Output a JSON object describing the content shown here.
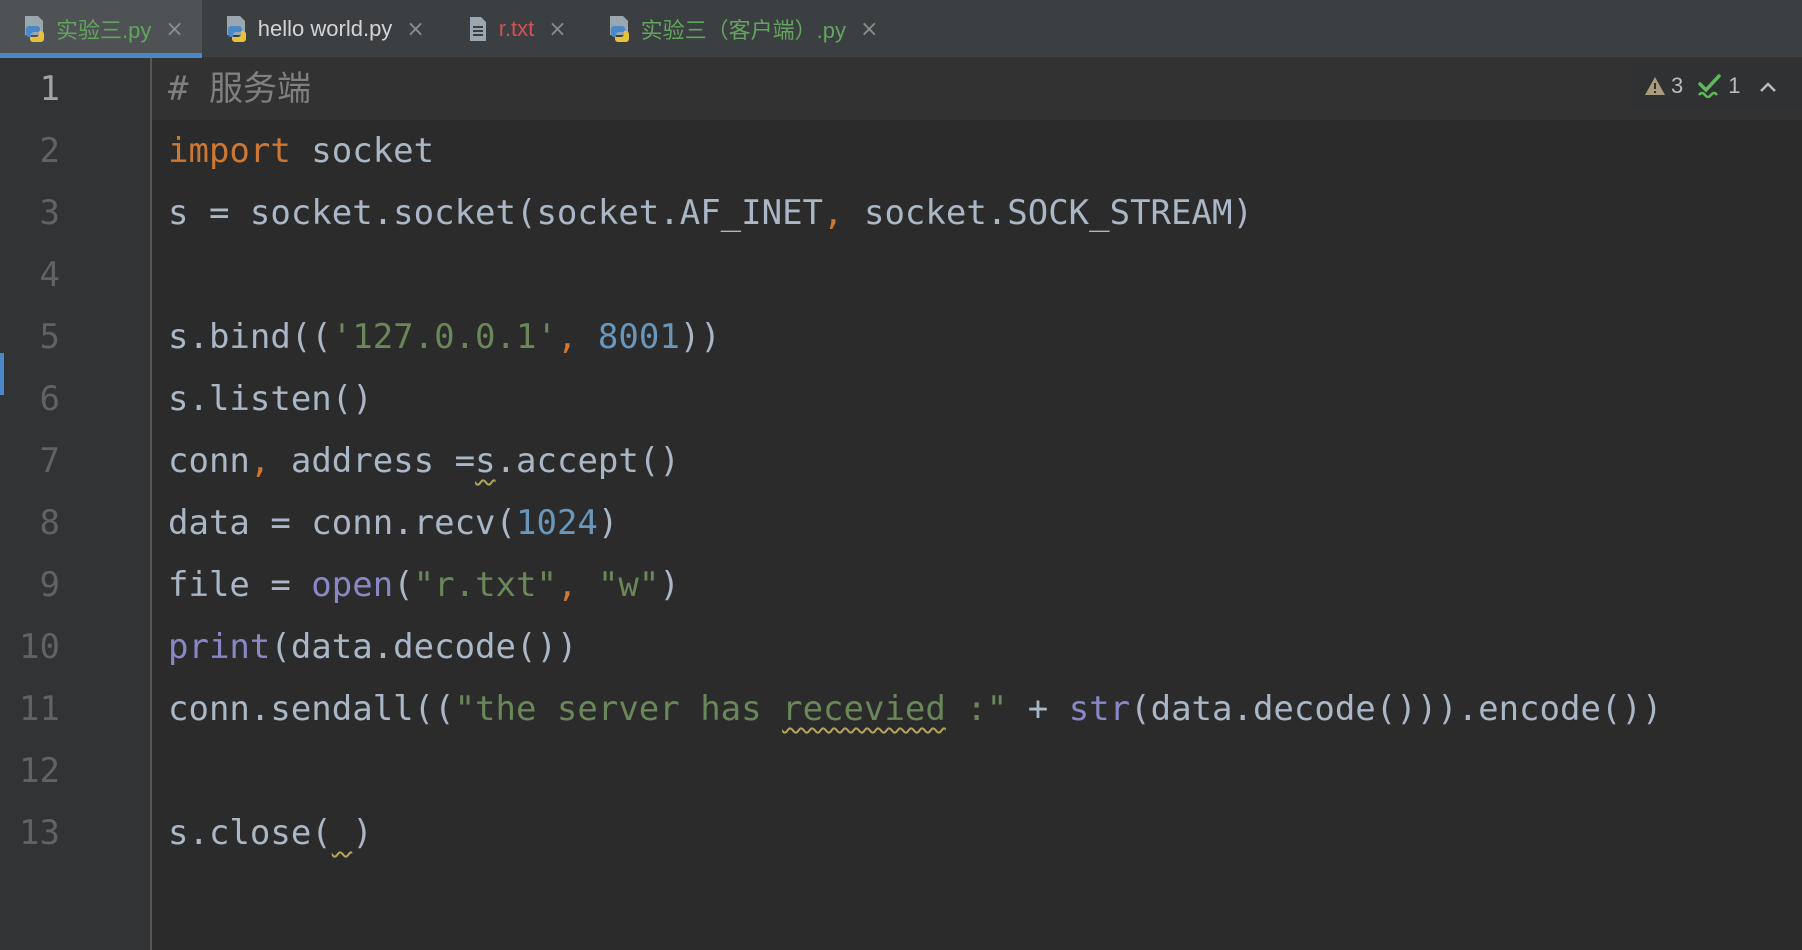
{
  "tabs": [
    {
      "label": "实验三.py",
      "type": "python",
      "color": "#62a55e",
      "active": true
    },
    {
      "label": "hello world.py",
      "type": "python",
      "color": "#d4d4d4",
      "active": false
    },
    {
      "label": "r.txt",
      "type": "text",
      "color": "#d25252",
      "active": false
    },
    {
      "label": "实验三（客户端）.py",
      "type": "python",
      "color": "#62a55e",
      "active": false
    }
  ],
  "tab_close_glyph": "×",
  "inspections": {
    "warnings_count": "3",
    "weak_warnings_count": "1",
    "warning_icon": "warning-triangle-icon",
    "weak_warning_icon": "check-squiggle-icon",
    "collapse_icon": "chevron-up-icon"
  },
  "editor": {
    "current_line": 1,
    "line_numbers": [
      "1",
      "2",
      "3",
      "4",
      "5",
      "6",
      "7",
      "8",
      "9",
      "10",
      "11",
      "12",
      "13"
    ],
    "lines": [
      {
        "tokens": [
          {
            "t": "# 服务端",
            "c": "comment"
          }
        ]
      },
      {
        "tokens": [
          {
            "t": "import",
            "c": "kw"
          },
          {
            "t": " socket",
            "c": "default"
          }
        ]
      },
      {
        "tokens": [
          {
            "t": "s = socket.socket(socket.AF_INET",
            "c": "default"
          },
          {
            "t": ",",
            "c": "comma"
          },
          {
            "t": " socket.SOCK_STREAM)",
            "c": "default"
          }
        ]
      },
      {
        "tokens": []
      },
      {
        "tokens": [
          {
            "t": "s.bind((",
            "c": "default"
          },
          {
            "t": "'127.0.0.1'",
            "c": "str"
          },
          {
            "t": ",",
            "c": "comma"
          },
          {
            "t": " ",
            "c": "default"
          },
          {
            "t": "8001",
            "c": "num"
          },
          {
            "t": "))",
            "c": "default"
          }
        ]
      },
      {
        "tokens": [
          {
            "t": "s.listen()",
            "c": "default"
          }
        ]
      },
      {
        "tokens": [
          {
            "t": "conn",
            "c": "default"
          },
          {
            "t": ",",
            "c": "comma"
          },
          {
            "t": " address =",
            "c": "default"
          },
          {
            "t": "s",
            "c": "default",
            "squiggle": true
          },
          {
            "t": ".accept()",
            "c": "default"
          }
        ]
      },
      {
        "tokens": [
          {
            "t": "data = conn.recv(",
            "c": "default"
          },
          {
            "t": "1024",
            "c": "num"
          },
          {
            "t": ")",
            "c": "default"
          }
        ]
      },
      {
        "tokens": [
          {
            "t": "file = ",
            "c": "default"
          },
          {
            "t": "open",
            "c": "builtin"
          },
          {
            "t": "(",
            "c": "default"
          },
          {
            "t": "\"r.txt\"",
            "c": "str"
          },
          {
            "t": ",",
            "c": "comma"
          },
          {
            "t": " ",
            "c": "default"
          },
          {
            "t": "\"w\"",
            "c": "str"
          },
          {
            "t": ")",
            "c": "default"
          }
        ]
      },
      {
        "tokens": [
          {
            "t": "print",
            "c": "builtin"
          },
          {
            "t": "(data.decode())",
            "c": "default"
          }
        ]
      },
      {
        "tokens": [
          {
            "t": "conn.sendall((",
            "c": "default"
          },
          {
            "t": "\"the server has ",
            "c": "str"
          },
          {
            "t": "recevied",
            "c": "str",
            "squiggle": true
          },
          {
            "t": " :\"",
            "c": "str"
          },
          {
            "t": " + ",
            "c": "default"
          },
          {
            "t": "str",
            "c": "builtin"
          },
          {
            "t": "(data.decode())).encode())",
            "c": "default"
          }
        ]
      },
      {
        "tokens": []
      },
      {
        "tokens": [
          {
            "t": "s.close(",
            "c": "default"
          },
          {
            "t": " ",
            "c": "default",
            "squiggle": true
          },
          {
            "t": ")",
            "c": "default"
          }
        ]
      }
    ]
  }
}
